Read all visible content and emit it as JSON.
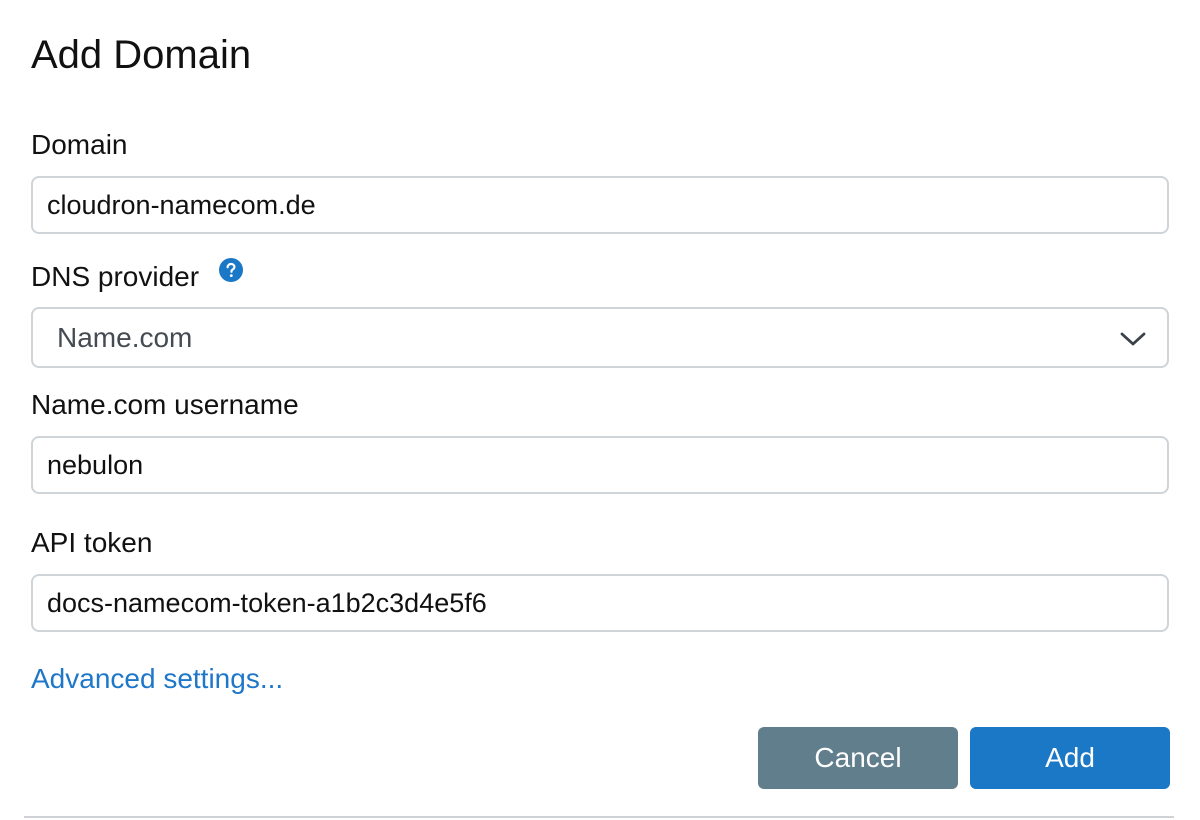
{
  "dialog": {
    "title": "Add Domain"
  },
  "form": {
    "domain": {
      "label": "Domain",
      "value": "cloudron-namecom.de"
    },
    "dns_provider": {
      "label": "DNS provider",
      "selected": "Name.com",
      "help_icon": "question-circle-icon",
      "dropdown_icon": "chevron-down-icon"
    },
    "username": {
      "label": "Name.com username",
      "value": "nebulon"
    },
    "api_token": {
      "label": "API token",
      "value": "docs-namecom-token-a1b2c3d4e5f6"
    },
    "advanced_link": "Advanced settings..."
  },
  "actions": {
    "cancel_label": "Cancel",
    "add_label": "Add"
  },
  "colors": {
    "primary": "#1b78c6",
    "cancel": "#617e8c",
    "link": "#1f77c9",
    "border": "#cfd4d9"
  }
}
